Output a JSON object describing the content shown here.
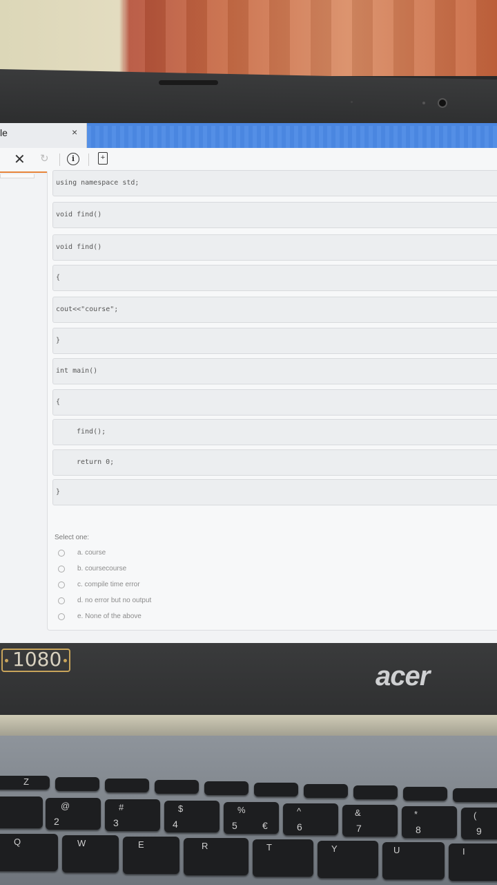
{
  "browser": {
    "tab_title": "le",
    "tab_close": "×",
    "stop_icon": "close-icon",
    "reload_icon": "reload-icon"
  },
  "code_lines": [
    "using namespace std;",
    "void find()",
    "void find()",
    "{",
    "cout<<\"course\";",
    "}",
    "int main()",
    "{",
    "find();",
    "return 0;",
    "}"
  ],
  "quiz": {
    "select_label": "Select one:",
    "options": [
      "a. course",
      "b. coursecourse",
      "c. compile time error",
      "d. no error but no output",
      "e. None of the above"
    ]
  },
  "laptop": {
    "resolution_badge": "1080",
    "brand": "acer"
  },
  "keyboard": {
    "number_row": [
      {
        "top": "@",
        "bottom": "2"
      },
      {
        "top": "#",
        "bottom": "3"
      },
      {
        "top": "$",
        "bottom": "4"
      },
      {
        "top": "%",
        "bottom": "5"
      },
      {
        "top": "^",
        "bottom": "6"
      },
      {
        "top": "&",
        "bottom": "7"
      },
      {
        "top": "*",
        "bottom": "8"
      },
      {
        "top": "(",
        "bottom": "9"
      }
    ],
    "euro": "€",
    "letter_row": [
      "Q",
      "W",
      "E",
      "R",
      "T",
      "Y",
      "U",
      "I"
    ],
    "fn_row_z": "Z"
  },
  "colors": {
    "tab_strip": "#4a86e0",
    "toolbar_accent": "#e8853a",
    "brand_text": "#cfd0d2",
    "badge_border": "#c9a55b"
  }
}
